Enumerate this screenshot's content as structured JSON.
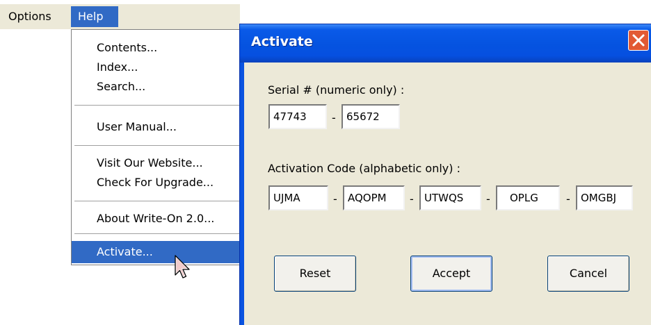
{
  "menubar": {
    "options": "Options",
    "help": "Help"
  },
  "help_menu": {
    "contents": "Contents...",
    "index": "Index...",
    "search": "Search...",
    "user_manual": "User Manual...",
    "visit_website": "Visit Our Website...",
    "check_upgrade": "Check For Upgrade...",
    "about": "About Write-On 2.0...",
    "activate": "Activate..."
  },
  "dialog": {
    "title": "Activate",
    "serial_label": "Serial # (numeric only) :",
    "serial": [
      "47743",
      "65672"
    ],
    "code_label": "Activation Code (alphabetic only) :",
    "code": [
      "UJMA",
      "AQOPM",
      "UTWQS",
      "OPLG",
      "OMGBJ"
    ],
    "separator": "-",
    "buttons": {
      "reset": "Reset",
      "accept": "Accept",
      "cancel": "Cancel"
    }
  },
  "colors": {
    "selection": "#316ac5",
    "dialog_face": "#ece9d8",
    "titlebar": "#0553e0",
    "close_button": "#e25a34"
  },
  "icons": {
    "close": "close-icon",
    "cursor": "mouse-pointer-icon"
  }
}
